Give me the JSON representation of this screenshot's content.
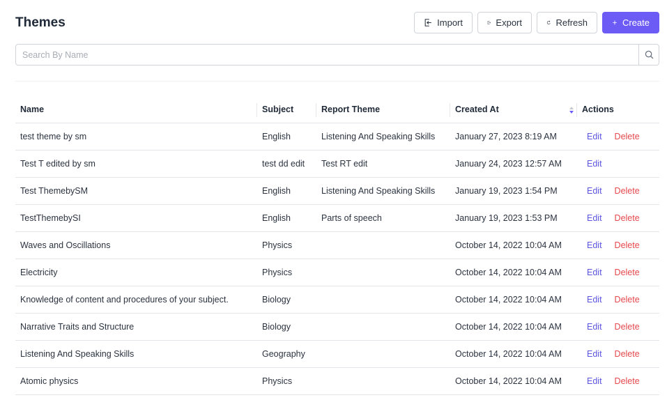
{
  "page": {
    "title": "Themes"
  },
  "toolbar": {
    "import_label": "Import",
    "export_label": "Export",
    "refresh_label": "Refresh",
    "create_label": "Create"
  },
  "search": {
    "placeholder": "Search By Name"
  },
  "table": {
    "columns": [
      "Name",
      "Subject",
      "Report Theme",
      "Created At",
      "Actions"
    ],
    "edit_label": "Edit",
    "delete_label": "Delete",
    "rows": [
      {
        "name": "test theme by sm",
        "subject": "English",
        "report_theme": "Listening And Speaking Skills",
        "created_at": "January 27, 2023 8:19 AM",
        "can_delete": true
      },
      {
        "name": "Test T edited by sm",
        "subject": "test dd edit",
        "report_theme": "Test RT edit",
        "created_at": "January 24, 2023 12:57 AM",
        "can_delete": false
      },
      {
        "name": "Test ThemebySM",
        "subject": "English",
        "report_theme": "Listening And Speaking Skills",
        "created_at": "January 19, 2023 1:54 PM",
        "can_delete": true
      },
      {
        "name": "TestThemebySI",
        "subject": "English",
        "report_theme": "Parts of speech",
        "created_at": "January 19, 2023 1:53 PM",
        "can_delete": true
      },
      {
        "name": "Waves and Oscillations",
        "subject": "Physics",
        "report_theme": "",
        "created_at": "October 14, 2022 10:04 AM",
        "can_delete": true
      },
      {
        "name": "Electricity",
        "subject": "Physics",
        "report_theme": "",
        "created_at": "October 14, 2022 10:04 AM",
        "can_delete": true
      },
      {
        "name": "Knowledge of content and procedures of your subject.",
        "subject": "Biology",
        "report_theme": "",
        "created_at": "October 14, 2022 10:04 AM",
        "can_delete": true
      },
      {
        "name": "Narrative Traits and Structure",
        "subject": "Biology",
        "report_theme": "",
        "created_at": "October 14, 2022 10:04 AM",
        "can_delete": true
      },
      {
        "name": "Listening And Speaking Skills",
        "subject": "Geography",
        "report_theme": "",
        "created_at": "October 14, 2022 10:04 AM",
        "can_delete": true
      },
      {
        "name": "Atomic physics",
        "subject": "Physics",
        "report_theme": "",
        "created_at": "October 14, 2022 10:04 AM",
        "can_delete": true
      }
    ]
  },
  "colors": {
    "accent": "#6d5bf5",
    "link": "#5b55e0",
    "danger": "#e5484d"
  }
}
